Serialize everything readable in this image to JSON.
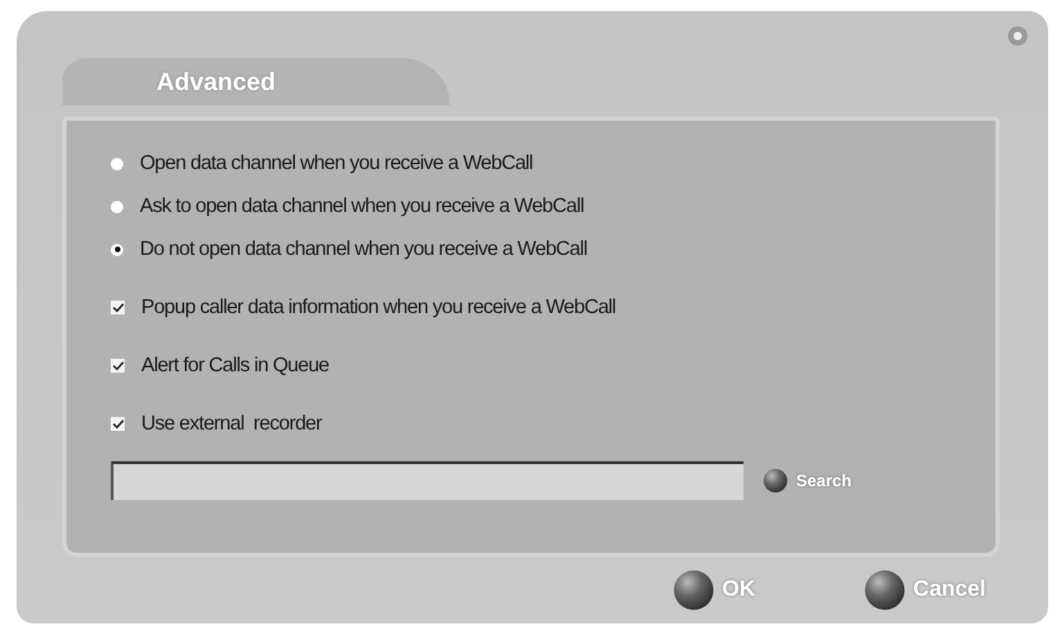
{
  "dialog": {
    "title": "Advanced"
  },
  "options": [
    {
      "kind": "radio",
      "label": "Open data channel when you receive a WebCall",
      "selected": false
    },
    {
      "kind": "radio",
      "label": "Ask to open data channel when you receive a WebCall",
      "selected": false
    },
    {
      "kind": "radio",
      "label": "Do not open data channel when you receive a WebCall",
      "selected": true
    },
    {
      "kind": "checkbox",
      "label": "Popup caller data information when you receive a WebCall",
      "checked": true
    },
    {
      "kind": "checkbox",
      "label": "Alert for Calls in Queue",
      "checked": true
    },
    {
      "kind": "checkbox",
      "label": "Use external  recorder",
      "checked": true
    }
  ],
  "search": {
    "button": "Search"
  },
  "buttons": [
    "OK",
    "Cancel"
  ]
}
